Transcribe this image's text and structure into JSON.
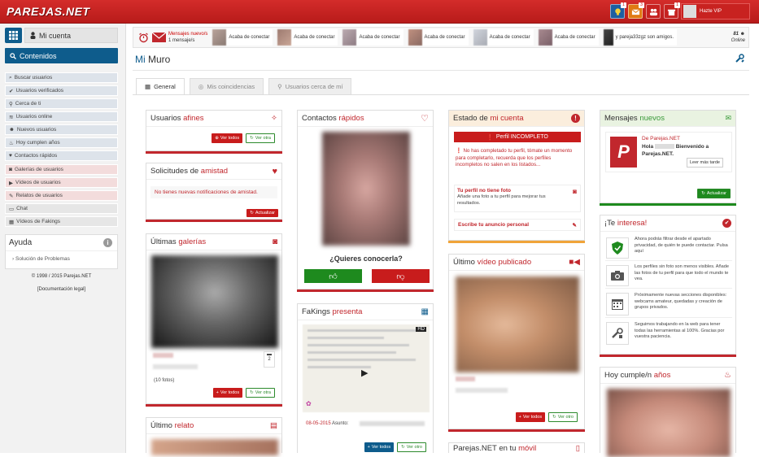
{
  "header": {
    "logo": "PAREJAS.NET",
    "badges": [
      "1",
      "3",
      "",
      "1"
    ],
    "user_status": "Hazte VIP"
  },
  "sidebar": {
    "mi_cuenta": "Mi cuenta",
    "contenidos": "Contenidos",
    "items": [
      {
        "label": "Buscar usuarios",
        "icon": "search-icon"
      },
      {
        "label": "Usuarios verificados",
        "icon": "check-icon"
      },
      {
        "label": "Cerca de ti",
        "icon": "map-pin-icon"
      },
      {
        "label": "Usuarios online",
        "icon": "wifi-icon"
      },
      {
        "label": "Nuevos usuarios",
        "icon": "users-icon"
      },
      {
        "label": "Hoy cumplen años",
        "icon": "cake-icon"
      },
      {
        "label": "Contactos rápidos",
        "icon": "heart-icon"
      },
      {
        "label": "Galerías de usuarios",
        "icon": "camera-icon"
      },
      {
        "label": "Vídeos de usuarios",
        "icon": "video-icon"
      },
      {
        "label": "Relatos de usuarios",
        "icon": "pencil-icon"
      },
      {
        "label": "Chat",
        "icon": "chat-icon"
      },
      {
        "label": "Vídeos de Fakings",
        "icon": "film-icon"
      }
    ],
    "ayuda_title": "Ayuda",
    "ayuda_item": "Solución de Problemas",
    "copyright": "© 1998 / 2015 Parejas.NET",
    "legal": "[Documentación legal]"
  },
  "ticker": {
    "mail_line1": "Mensajes nuevo/s",
    "mail_line2": "1 mensaje/s",
    "entries": [
      {
        "text": "Acaba de conectar"
      },
      {
        "text": "Acaba de conectar"
      },
      {
        "text": "Acaba de conectar"
      },
      {
        "text": "Acaba de conectar"
      },
      {
        "text": "Acaba de conectar"
      },
      {
        "text": "Acaba de conectar"
      },
      {
        "text": "y pareja33zgz son amigos."
      }
    ],
    "online_count": "81",
    "online_label": "Online"
  },
  "muro": {
    "title_part1": "Mi",
    "title_part2": "Muro"
  },
  "tabs": [
    {
      "label": "General",
      "icon": "grid-icon"
    },
    {
      "label": "Mis coincidencias",
      "icon": "target-icon"
    },
    {
      "label": "Usuarios cerca de mí",
      "icon": "map-pin-icon"
    }
  ],
  "col1": {
    "afines_t1": "Usuarios",
    "afines_t2": "afines",
    "ver_todos": "Ver todos",
    "ver_otra": "Ver otra",
    "amistad_t1": "Solicitudes de",
    "amistad_t2": "amistad",
    "amistad_msg": "No tienes nuevas notificaciones de amistad.",
    "actualizar": "Actualizar",
    "galerias_t1": "Últimas",
    "galerias_t2": "galerías",
    "fotos": "(10 fotos)",
    "comments": "2",
    "ver_otra2": "Ver otra",
    "relato_t1": "Último",
    "relato_t2": "relato"
  },
  "col2": {
    "contactos_t1": "Contactos",
    "contactos_t2": "rápidos",
    "question": "¿Quieres conocerla?",
    "fakings_t1": "FaKings",
    "fakings_t2": "presenta",
    "hd": "HD",
    "date": "08-05-2015",
    "asunto": "Asunto:",
    "ver_todos": "Ver todos",
    "ver_otro": "Ver otro"
  },
  "col3": {
    "estado_t1": "Estado de",
    "estado_t2": "mi cuenta",
    "perfil": "Perfil INCOMPLETO",
    "perfil_msg": "No has completado tu perfil, tómate un momento para completarlo, recuerda que los perfiles incompletos no salen en los listados...",
    "foto_title": "Tu perfil no tiene foto",
    "foto_msg": "Añade una foto a tu perfil para mejorar tus resultados.",
    "anuncio": "Escribe tu anuncio personal",
    "video_t1": "Último",
    "video_t2": "vídeo publicado",
    "ver_todos": "Ver todos",
    "ver_otro": "Ver otro",
    "movil_t1": "Parejas.NET en tu",
    "movil_t2": "móvil"
  },
  "col4": {
    "mensajes_t1": "Mensajes",
    "mensajes_t2": "nuevos",
    "from": "De Parejas.NET",
    "hola": "Hola",
    "msg": "Bienvenido a Parejas.NET.",
    "leer": "Leer más tarde",
    "actualizar": "Actualizar",
    "interesa_t1": "¡Te",
    "interesa_t2": "interesa!",
    "tips": [
      "Ahora podrás filtrar desde el apartado privacidad, de quién te puede contactar. Pulsa aquí",
      "Los perfiles sin foto son menos visibles. Añade las fotos de tu perfil para que todo el mundo te vea.",
      "Próximamente nuevas secciones disponibles: webcams amateur, quedadas y creación de grupos privados.",
      "Seguimos trabajando en la web para tener todas las herramientas al 100%. Gracias por vuestra paciencia."
    ],
    "cumple_t1": "Hoy cumple/n",
    "cumple_t2": "años"
  },
  "colors": {
    "brand": "#c1272d",
    "nav": "#0e5c8c",
    "green": "#1e8a1e"
  }
}
